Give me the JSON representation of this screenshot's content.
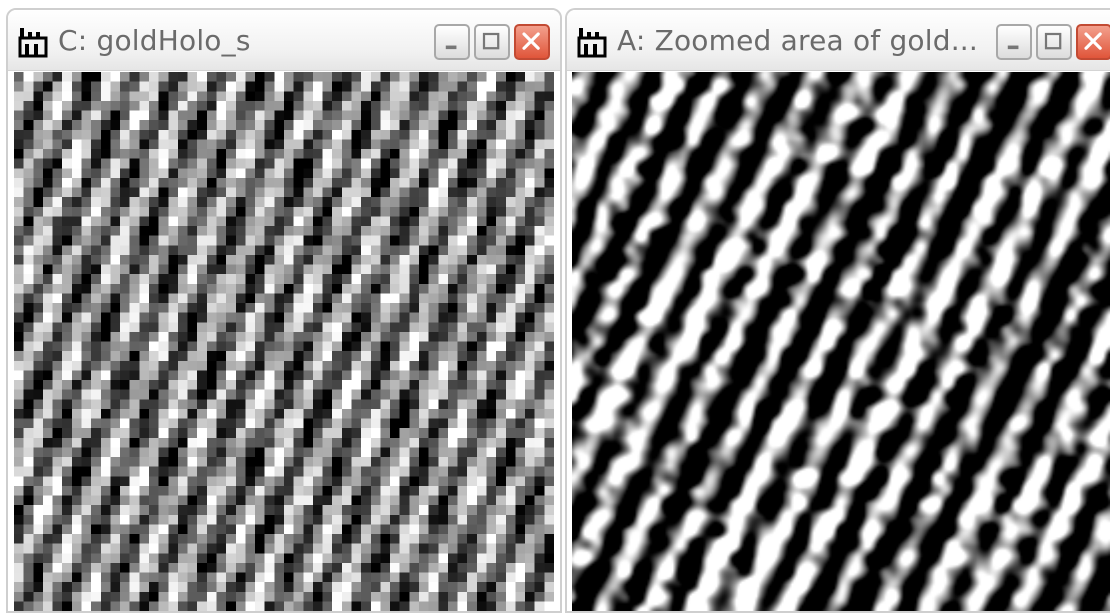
{
  "windows": [
    {
      "id": "C",
      "title": "C: goldHolo_s",
      "icon": "imagej-microscope-icon",
      "buttons": [
        "minimize-icon",
        "maximize-icon",
        "close-icon"
      ],
      "content": "hologram-pixelated"
    },
    {
      "id": "A",
      "title": "A: Zoomed area of gold...",
      "icon": "imagej-microscope-icon",
      "buttons": [
        "minimize-icon",
        "maximize-icon",
        "close-icon"
      ],
      "content": "hologram-smooth"
    }
  ],
  "colors": {
    "title_text": "#6b6b6b",
    "close_button": "#e0553a",
    "window_border": "#cfcfcf"
  }
}
